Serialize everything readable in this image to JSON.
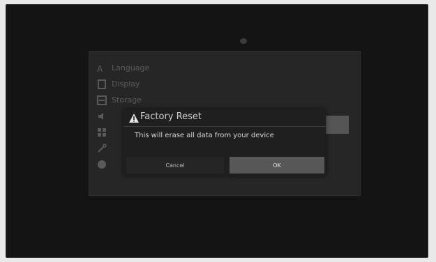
{
  "dialog": {
    "title": "Factory Reset",
    "message": "This will erase all data from your device",
    "cancel_label": "Cancel",
    "ok_label": "OK",
    "warning_icon": "warning-icon"
  },
  "settings": {
    "items": [
      {
        "label": "Language",
        "icon": "language-icon"
      },
      {
        "label": "Display",
        "icon": "display-icon"
      },
      {
        "label": "Storage",
        "icon": "storage-icon"
      },
      {
        "label": "",
        "icon": "sound-icon"
      },
      {
        "label": "",
        "icon": "apps-icon"
      },
      {
        "label": "",
        "icon": "wrench-icon"
      },
      {
        "label": "",
        "icon": "globe-icon"
      }
    ]
  }
}
